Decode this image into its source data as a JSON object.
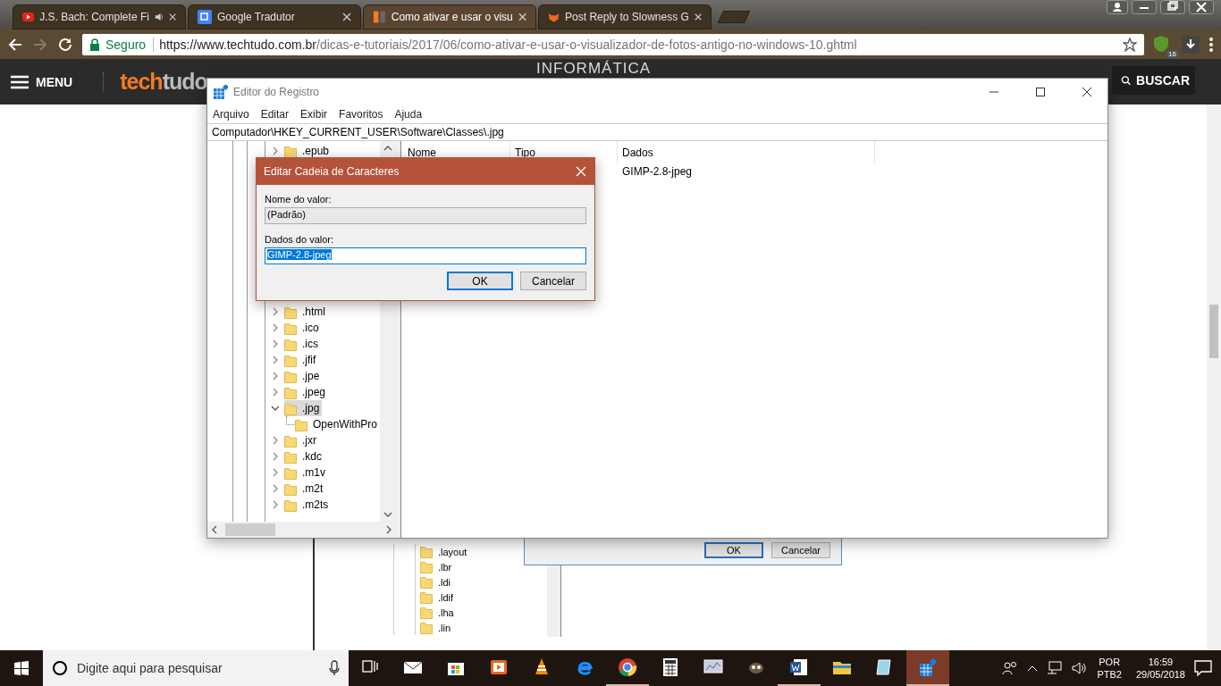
{
  "browser": {
    "tabs": [
      {
        "title": "J.S. Bach: Complete Fi",
        "selected": false,
        "audio": true,
        "kind": "video"
      },
      {
        "title": "Google Tradutor",
        "selected": false,
        "audio": false,
        "kind": "translate"
      },
      {
        "title": "Como ativar e usar o visu",
        "selected": true,
        "audio": false,
        "kind": "site"
      },
      {
        "title": "Post Reply to Slowness G",
        "selected": false,
        "audio": false,
        "kind": "forum"
      }
    ],
    "security_label": "Seguro",
    "url_host": "https://www.techtudo.com.br",
    "url_path": "/dicas-e-tutoriais/2017/06/como-ativar-e-usar-o-visualizador-de-fotos-antigo-no-windows-10.ghtml",
    "extension_badge": "16"
  },
  "page": {
    "menu_label": "MENU",
    "logo_first": "tech",
    "logo_second": "tudo",
    "section_title": "INFORMÁTICA",
    "search_label": "BUSCAR",
    "article_image": {
      "tree_items": [
        ".layout",
        ".lbr",
        ".ldi",
        ".ldif",
        ".lha",
        ".lin"
      ],
      "buttons": [
        {
          "label": "OK",
          "default": true
        },
        {
          "label": "Cancelar",
          "default": false
        }
      ]
    }
  },
  "regedit": {
    "title": "Editor do Registro",
    "menu": [
      "Arquivo",
      "Editar",
      "Exibir",
      "Favoritos",
      "Ajuda"
    ],
    "address": "Computador\\HKEY_CURRENT_USER\\Software\\Classes\\.jpg",
    "tree": [
      {
        "label": ".epub",
        "expanded": false,
        "selected": false
      },
      {
        "label": ".html",
        "expanded": false,
        "selected": false
      },
      {
        "label": ".ico",
        "expanded": false,
        "selected": false
      },
      {
        "label": ".ics",
        "expanded": false,
        "selected": false
      },
      {
        "label": ".jfif",
        "expanded": false,
        "selected": false
      },
      {
        "label": ".jpe",
        "expanded": false,
        "selected": false
      },
      {
        "label": ".jpeg",
        "expanded": false,
        "selected": false
      },
      {
        "label": ".jpg",
        "expanded": true,
        "selected": true,
        "children": [
          {
            "label": "OpenWithPro",
            "selected": false
          }
        ]
      },
      {
        "label": ".jxr",
        "expanded": false,
        "selected": false
      },
      {
        "label": ".kdc",
        "expanded": false,
        "selected": false
      },
      {
        "label": ".m1v",
        "expanded": false,
        "selected": false
      },
      {
        "label": ".m2t",
        "expanded": false,
        "selected": false
      },
      {
        "label": ".m2ts",
        "expanded": false,
        "selected": false
      }
    ],
    "columns": [
      "Nome",
      "Tipo",
      "Dados"
    ],
    "rows": [
      {
        "dados": "GIMP-2.8-jpeg"
      }
    ]
  },
  "dialog": {
    "title": "Editar Cadeia de Caracteres",
    "name_label": "Nome do valor:",
    "name_value": "(Padrão)",
    "data_label": "Dados do valor:",
    "data_value": "GIMP-2.8-jpeg",
    "buttons": [
      {
        "label": "OK",
        "default": true
      },
      {
        "label": "Cancelar",
        "default": false
      }
    ]
  },
  "taskbar": {
    "search_placeholder": "Digite aqui para pesquisar",
    "apps": [
      {
        "kind": "taskview",
        "active": false
      },
      {
        "kind": "mail",
        "active": false
      },
      {
        "kind": "store",
        "active": false
      },
      {
        "kind": "media",
        "active": false
      },
      {
        "kind": "cone",
        "active": false
      },
      {
        "kind": "edge",
        "active": false
      },
      {
        "kind": "chrome",
        "active": true
      },
      {
        "kind": "calculator",
        "active": false
      },
      {
        "kind": "monitor",
        "active": false
      },
      {
        "kind": "gimp",
        "active": false
      },
      {
        "kind": "word",
        "active": true
      },
      {
        "kind": "folder",
        "active": false
      },
      {
        "kind": "notepad",
        "active": false
      },
      {
        "kind": "regedit",
        "active": true
      }
    ],
    "language": "POR",
    "layout": "PTB2",
    "time": "16:59",
    "date": "29/05/2018"
  }
}
